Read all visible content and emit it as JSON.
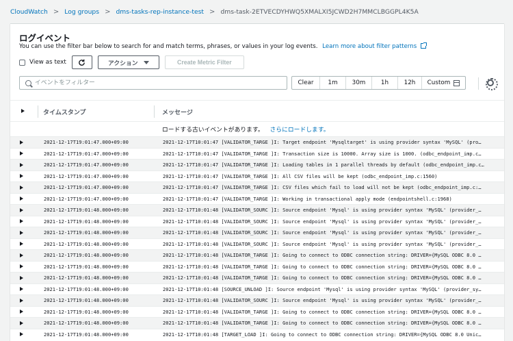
{
  "breadcrumb": {
    "items": [
      "CloudWatch",
      "Log groups",
      "dms-tasks-rep-instance-test"
    ],
    "current": "dms-task-2ETVECDYHWQ5XMALXI5JCWD2H7MMCLBGGPL4K5A"
  },
  "header": {
    "title": "ログイベント",
    "subtitle": "You can use the filter bar below to search for and match terms, phrases, or values in your log events.",
    "learn_more": "Learn more about filter patterns"
  },
  "toolbar": {
    "view_as_text": "View as text",
    "action_label": "アクション",
    "create_metric_filter": "Create Metric Filter"
  },
  "filter": {
    "placeholder": "イベントをフィルター"
  },
  "timerange": {
    "clear": "Clear",
    "options": [
      "1m",
      "30m",
      "1h",
      "12h"
    ],
    "custom": "Custom"
  },
  "table": {
    "col_timestamp": "タイムスタンプ",
    "col_message": "メッセージ",
    "load_older": "ロードする古いイベントがあります。",
    "load_more_link": "さらにロードします。",
    "rows": [
      {
        "ts": "2021-12-17T19:01:47.000+09:00",
        "msg": "2021-12-17T10:01:47 [VALIDATOR_TARGE ]I: Target endpoint 'Mysqltarget' is using provider syntax 'MySQL' (pro…"
      },
      {
        "ts": "2021-12-17T19:01:47.000+09:00",
        "msg": "2021-12-17T10:01:47 [VALIDATOR_TARGE ]I: Transaction size is 10000. Array size is 1000. (odbc_endpoint_imp.c…"
      },
      {
        "ts": "2021-12-17T19:01:47.000+09:00",
        "msg": "2021-12-17T10:01:47 [VALIDATOR_TARGE ]I: Loading tables in 1 parallel threads by default (odbc_endpoint_imp.c…"
      },
      {
        "ts": "2021-12-17T19:01:47.000+09:00",
        "msg": "2021-12-17T10:01:47 [VALIDATOR_TARGE ]I: All CSV files will be kept (odbc_endpoint_imp.c:1560)"
      },
      {
        "ts": "2021-12-17T19:01:47.000+09:00",
        "msg": "2021-12-17T10:01:47 [VALIDATOR_TARGE ]I: CSV files which fail to load will not be kept (odbc_endpoint_imp.c:…"
      },
      {
        "ts": "2021-12-17T19:01:47.000+09:00",
        "msg": "2021-12-17T10:01:47 [VALIDATOR_TARGE ]I: Working in transactional apply mode (endpointshell.c:1968)"
      },
      {
        "ts": "2021-12-17T19:01:48.000+09:00",
        "msg": "2021-12-17T10:01:48 [VALIDATOR_SOURC ]I: Source endpoint 'Mysql' is using provider syntax 'MySQL' (provider_…"
      },
      {
        "ts": "2021-12-17T19:01:48.000+09:00",
        "msg": "2021-12-17T10:01:48 [VALIDATOR_SOURC ]I: Source endpoint 'Mysql' is using provider syntax 'MySQL' (provider_…"
      },
      {
        "ts": "2021-12-17T19:01:48.000+09:00",
        "msg": "2021-12-17T10:01:48 [VALIDATOR_SOURC ]I: Source endpoint 'Mysql' is using provider syntax 'MySQL' (provider_…"
      },
      {
        "ts": "2021-12-17T19:01:48.000+09:00",
        "msg": "2021-12-17T10:01:48 [VALIDATOR_SOURC ]I: Source endpoint 'Mysql' is using provider syntax 'MySQL' (provider_…"
      },
      {
        "ts": "2021-12-17T19:01:48.000+09:00",
        "msg": "2021-12-17T10:01:48 [VALIDATOR_TARGE ]I: Going to connect to ODBC connection string: DRIVER={MySQL ODBC 8.0 …"
      },
      {
        "ts": "2021-12-17T19:01:48.000+09:00",
        "msg": "2021-12-17T10:01:48 [VALIDATOR_TARGE ]I: Going to connect to ODBC connection string: DRIVER={MySQL ODBC 8.0 …"
      },
      {
        "ts": "2021-12-17T19:01:48.000+09:00",
        "msg": "2021-12-17T10:01:48 [VALIDATOR_TARGE ]I: Going to connect to ODBC connection string: DRIVER={MySQL ODBC 8.0 …"
      },
      {
        "ts": "2021-12-17T19:01:48.000+09:00",
        "msg": "2021-12-17T10:01:48 [SOURCE_UNLOAD ]I: Source endpoint 'Mysql' is using provider syntax 'MySQL' (provider_sy…"
      },
      {
        "ts": "2021-12-17T19:01:48.000+09:00",
        "msg": "2021-12-17T10:01:48 [VALIDATOR_SOURC ]I: Source endpoint 'Mysql' is using provider syntax 'MySQL' (provider_…"
      },
      {
        "ts": "2021-12-17T19:01:48.000+09:00",
        "msg": "2021-12-17T10:01:48 [VALIDATOR_TARGE ]I: Going to connect to ODBC connection string: DRIVER={MySQL ODBC 8.0 …"
      },
      {
        "ts": "2021-12-17T19:01:48.000+09:00",
        "msg": "2021-12-17T10:01:48 [VALIDATOR_TARGE ]I: Going to connect to ODBC connection string: DRIVER={MySQL ODBC 8.0 …"
      },
      {
        "ts": "2021-12-17T19:01:48.000+09:00",
        "msg": "2021-12-17T10:01:48 [TARGET_LOAD ]I: Going to connect to ODBC connection string: DRIVER={MySQL ODBC 8.0 Unic…"
      }
    ]
  },
  "colors": {
    "link": "#0073bb",
    "background": "#f2f3f3",
    "panel": "#ffffff",
    "row_alt": "#f2f3f3"
  }
}
